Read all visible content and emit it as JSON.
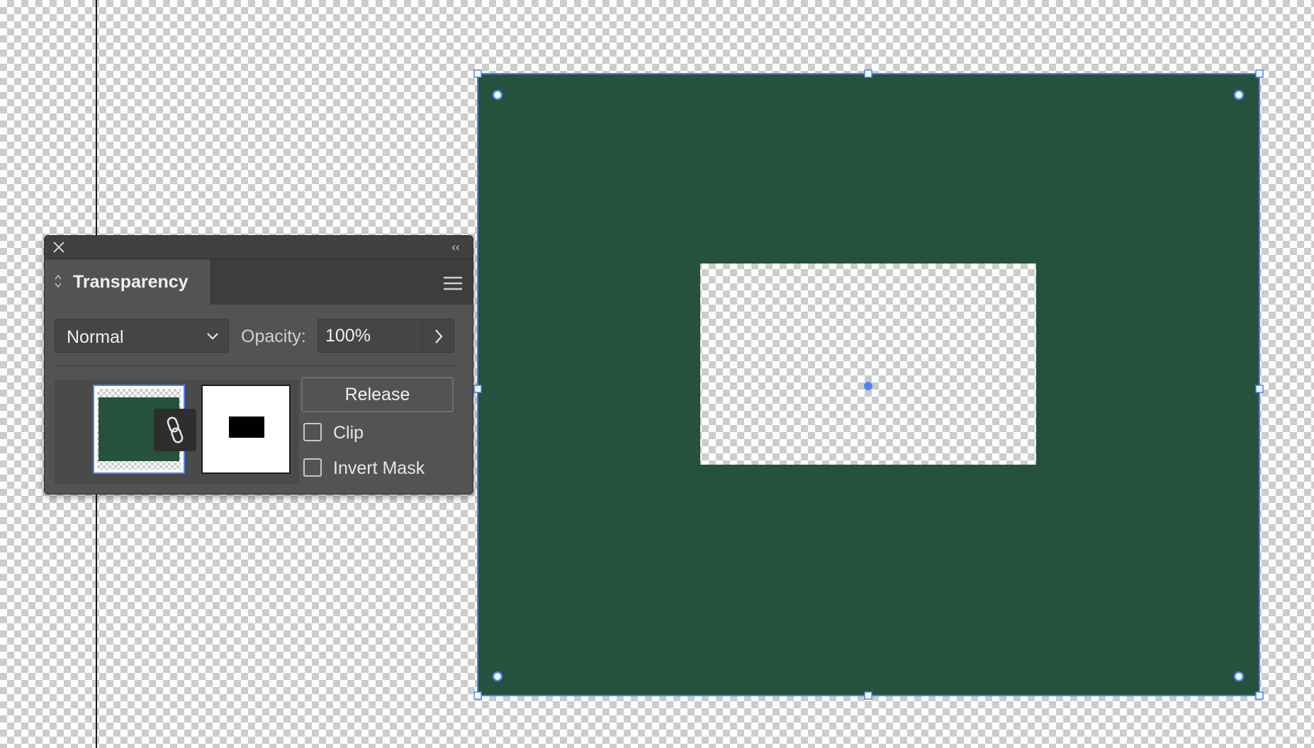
{
  "panel": {
    "title": "Transparency",
    "collapse_glyph": "‹‹",
    "blend_mode": "Normal",
    "opacity_label": "Opacity:",
    "opacity_value": "100%",
    "release_label": "Release",
    "clip_label": "Clip",
    "clip_checked": false,
    "invert_mask_label": "Invert Mask",
    "invert_mask_checked": false,
    "icons": {
      "close": "close-icon",
      "collapse": "collapse-panel-icon",
      "menu": "panel-menu-icon",
      "tab_arrows": "expand-arrows-icon",
      "chevron": "chevron-down-icon",
      "arrow": "chevron-right-icon",
      "link": "link-icon"
    }
  },
  "colors": {
    "artwork_fill": "#24523D",
    "selection": "#4A83FF",
    "panel_bg": "#535353",
    "canvas_check": "#CCCCCC"
  }
}
